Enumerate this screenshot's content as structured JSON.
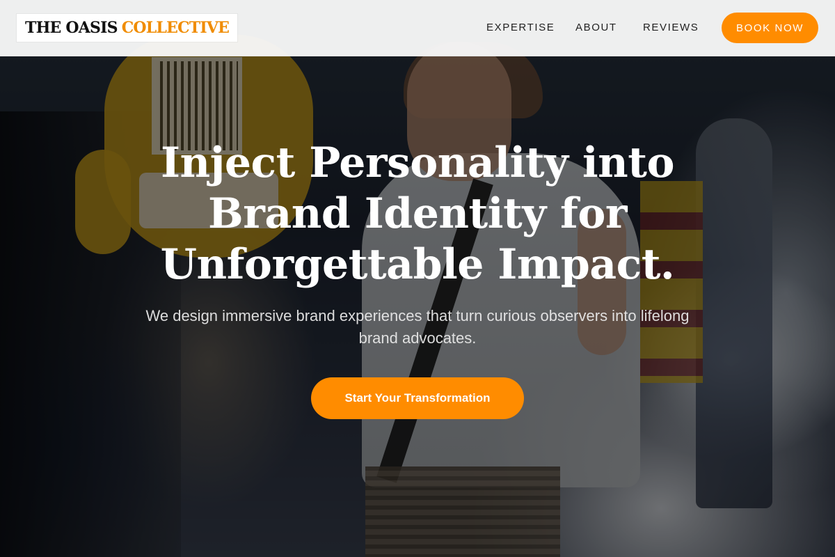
{
  "brand": {
    "name_part1": "THE OASIS",
    "name_part2": "COLLECTIVE",
    "accent_color": "#f08c00"
  },
  "nav": {
    "links": [
      {
        "label": "EXPERTISE"
      },
      {
        "label": "ABOUT"
      },
      {
        "label": "REVIEWS"
      }
    ],
    "cta_label": "BOOK NOW"
  },
  "hero": {
    "title_lines": [
      "Inject Personality into",
      "Brand Identity for",
      "Unforgettable Impact."
    ],
    "subtitle": "We design immersive brand experiences that turn curious observers into lifelong brand advocates.",
    "cta_label": "Start Your Transformation",
    "button_color": "#ff8c00"
  }
}
